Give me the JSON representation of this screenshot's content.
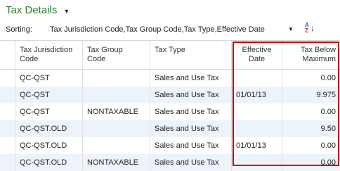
{
  "page": {
    "title": "Tax Details"
  },
  "sorting": {
    "label": "Sorting:",
    "value": "Tax Jurisdiction Code,Tax Group Code,Tax Type,Effective Date"
  },
  "table": {
    "columns": [
      {
        "line1": "Tax Jurisdiction",
        "line2": "Code"
      },
      {
        "line1": "Tax Group",
        "line2": "Code"
      },
      {
        "line1": "Tax Type",
        "line2": ""
      },
      {
        "line1": "Effective",
        "line2": "Date"
      },
      {
        "line1": "Tax Below",
        "line2": "Maximum"
      }
    ],
    "rows": [
      {
        "jurisdiction": "QC-QST",
        "group": "",
        "type": "Sales and Use Tax",
        "date": "",
        "tax": "0.00"
      },
      {
        "jurisdiction": "QC-QST",
        "group": "",
        "type": "Sales and Use Tax",
        "date": "01/01/13",
        "tax": "9.975"
      },
      {
        "jurisdiction": "QC-QST",
        "group": "NONTAXABLE",
        "type": "Sales and Use Tax",
        "date": "",
        "tax": "0.00"
      },
      {
        "jurisdiction": "QC-QST.OLD",
        "group": "",
        "type": "Sales and Use Tax",
        "date": "",
        "tax": "9.50"
      },
      {
        "jurisdiction": "QC-QST.OLD",
        "group": "",
        "type": "Sales and Use Tax",
        "date": "01/01/13",
        "tax": "0.00"
      },
      {
        "jurisdiction": "QC-QST.OLD",
        "group": "NONTAXABLE",
        "type": "Sales and Use Tax",
        "date": "",
        "tax": "0.00"
      }
    ]
  },
  "colors": {
    "title": "#2e7d32",
    "highlight_border": "#c00000",
    "alt_row": "#eef3fa"
  }
}
